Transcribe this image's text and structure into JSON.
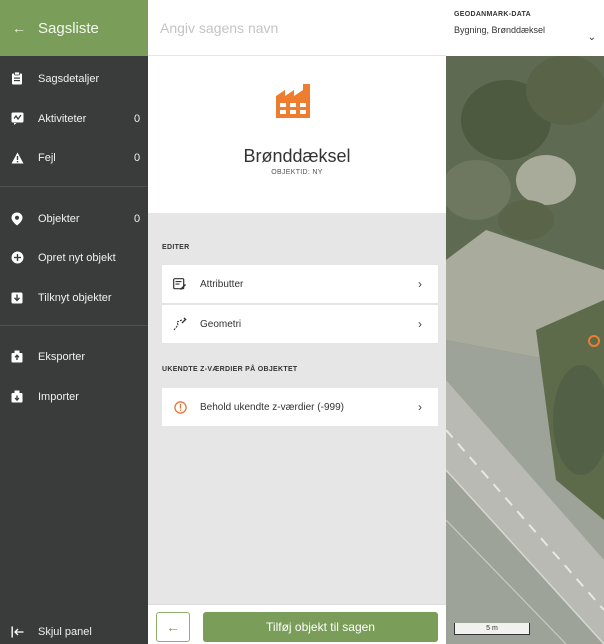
{
  "sidebar": {
    "title": "Sagsliste",
    "items": [
      {
        "label": "Sagsdetaljer",
        "icon": "clipboard-icon",
        "count": ""
      },
      {
        "label": "Aktiviteter",
        "icon": "activity-icon",
        "count": "0"
      },
      {
        "label": "Fejl",
        "icon": "warning-icon",
        "count": "0"
      },
      {
        "label": "Objekter",
        "icon": "location-pin-icon",
        "count": "0"
      },
      {
        "label": "Opret nyt objekt",
        "icon": "add-circle-icon",
        "count": ""
      },
      {
        "label": "Tilknyt objekter",
        "icon": "link-download-icon",
        "count": ""
      },
      {
        "label": "Eksporter",
        "icon": "export-icon",
        "count": ""
      },
      {
        "label": "Importer",
        "icon": "import-icon",
        "count": ""
      }
    ],
    "hide_panel_label": "Skjul panel"
  },
  "case": {
    "name_placeholder": "Angiv sagens navn"
  },
  "object": {
    "title": "Brønddæksel",
    "subtitle": "OBJEKTID: NY",
    "icon": "factory-icon"
  },
  "edit_section": {
    "label": "EDITER",
    "rows": [
      {
        "label": "Attributter",
        "icon": "attributes-icon"
      },
      {
        "label": "Geometri",
        "icon": "geometry-icon"
      }
    ]
  },
  "z_section": {
    "label": "UKENDTE Z-VÆRDIER PÅ OBJEKTET",
    "rows": [
      {
        "label": "Behold ukendte z-værdier (-999)",
        "icon": "info-circle-icon"
      }
    ]
  },
  "footer": {
    "back_symbol": "←",
    "add_label": "Tilføj objekt til sagen"
  },
  "map": {
    "layer_label": "GEODANMARK-DATA",
    "layer_value": "Bygning, Brønddæksel",
    "scale_label": "5 m"
  },
  "colors": {
    "accent": "#7a9e5a",
    "sidebar_bg": "#3a3c3b",
    "factory_orange": "#ee7d2f",
    "error_orange": "#ec6b2d"
  }
}
